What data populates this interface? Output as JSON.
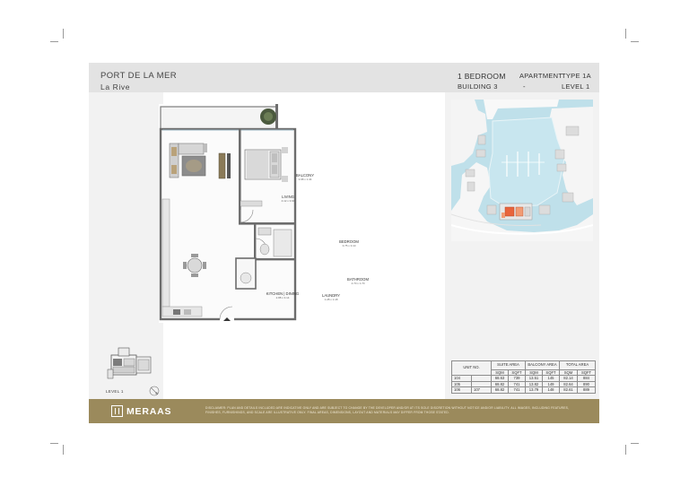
{
  "header": {
    "project": "PORT DE LA MER",
    "development": "La Rive",
    "unit_type": "1 BEDROOM",
    "building": "BUILDING 3",
    "category_label": "APARTMENT",
    "type": "TYPE 1A",
    "dash": "-",
    "level": "LEVEL 1"
  },
  "floorplan": {
    "rooms": [
      {
        "name": "BALCONY",
        "dim": "3.68 x 1.34"
      },
      {
        "name": "LIVING",
        "dim": "4.12 x 3.64"
      },
      {
        "name": "BEDROOM",
        "dim": "3.75 x 3.10"
      },
      {
        "name": "BATHROOM",
        "dim": "2.70 x 1.70"
      },
      {
        "name": "KITCHEN | DINING",
        "dim": "2.88 x 3.14"
      },
      {
        "name": "LAUNDRY",
        "dim": "1.28 x 1.18"
      }
    ]
  },
  "keyplan": {
    "level_label": "LEVEL 1"
  },
  "table": {
    "headers": {
      "unit_no": "UNIT NO.",
      "suite": "SUITE AREA",
      "balcony": "BALCONY AREA",
      "total": "TOTAL AREA",
      "sqm": "SQM",
      "sqft": "SQFT"
    },
    "rows": [
      {
        "u1": "104",
        "u2": "",
        "suite_sqm": "68.63",
        "suite_sqft": "739",
        "bal_sqm": "13.51",
        "bal_sqft": "145",
        "tot_sqm": "82.14",
        "tot_sqft": "884"
      },
      {
        "u1": "105",
        "u2": "",
        "suite_sqm": "68.82",
        "suite_sqft": "741",
        "bal_sqm": "13.82",
        "bal_sqft": "149",
        "tot_sqm": "82.64",
        "tot_sqft": "890"
      },
      {
        "u1": "106",
        "u2": "107",
        "suite_sqm": "68.82",
        "suite_sqft": "741",
        "bal_sqm": "13.79",
        "bal_sqft": "148",
        "tot_sqm": "82.61",
        "tot_sqft": "889"
      }
    ]
  },
  "footer": {
    "brand": "MERAAS",
    "disclaimer": "DISCLAIMER: PLAN AND DETAILS INCLUDED ARE INDICATIVE ONLY AND ARE SUBJECT TO CHANGE BY THE DEVELOPER AND/OR AT ITS SOLE DISCRETION WITHOUT NOTICE AND/OR LIABILITY. ALL IMAGES, INCLUDING FEATURES, FINISHES, FURNISHINGS, AND SCALE ARE ILLUSTRATIVE ONLY. FINAL AREAS, DIMENSIONS, LAYOUT AND MATERIALS MAY DIFFER FROM THOSE STATED."
  },
  "colors": {
    "header_bg": "#e3e3e3",
    "panel_bg": "#f2f2f2",
    "footer_gold": "#9b8a5c",
    "water": "#bfe0ea",
    "highlight": "#e8643c"
  }
}
